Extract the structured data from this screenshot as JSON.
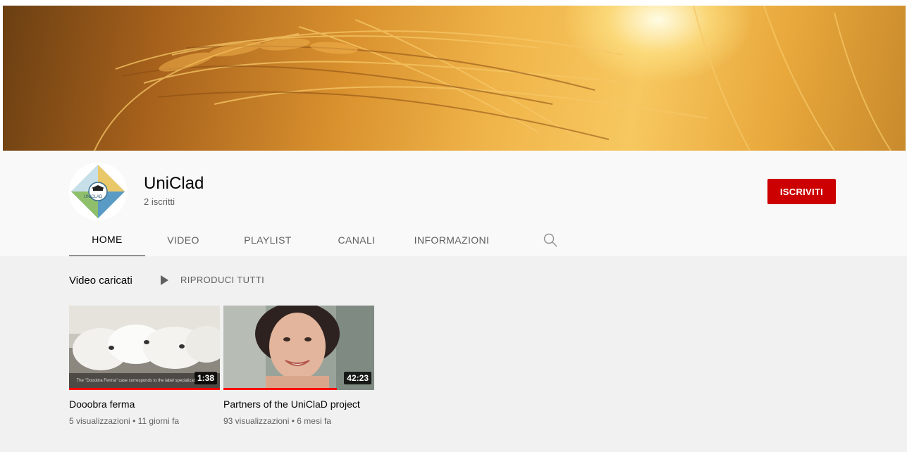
{
  "channel": {
    "name": "UniClad",
    "subscribers": "2 iscritti",
    "avatar_text": "UNICLAD",
    "subscribe_label": "ISCRIVITI",
    "accent_color": "#cc0000"
  },
  "tabs": [
    {
      "label": "HOME",
      "active": true
    },
    {
      "label": "VIDEO",
      "active": false
    },
    {
      "label": "PLAYLIST",
      "active": false
    },
    {
      "label": "CANALI",
      "active": false
    },
    {
      "label": "INFORMAZIONI",
      "active": false
    }
  ],
  "tab_search_icon": "search-icon",
  "section": {
    "title": "Video caricati",
    "play_all_label": "RIPRODUCI TUTTI"
  },
  "videos": [
    {
      "title": "Dooobra ferma",
      "duration": "1:38",
      "views": "5 visualizzazioni",
      "age": "11 giorni fa",
      "watched_fraction": 1.0,
      "caption": "The \"Dooobra Ferma\" case corresponds to the label specialization which"
    },
    {
      "title": "Partners of the UniClaD project",
      "duration": "42:23",
      "views": "93 visualizzazioni",
      "age": "6 mesi fa",
      "watched_fraction": 0.75
    }
  ]
}
